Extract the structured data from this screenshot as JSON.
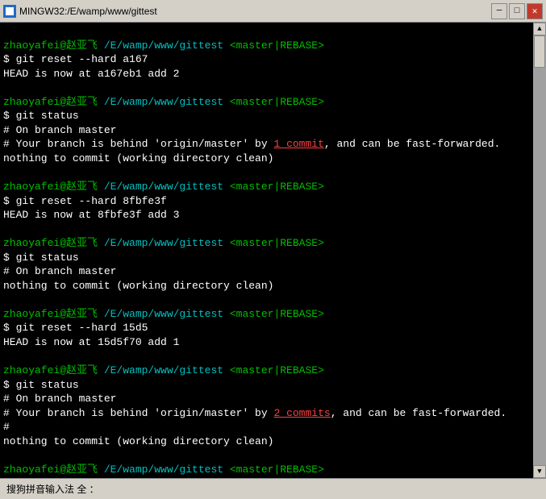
{
  "titlebar": {
    "title": "MINGW32:/E/wamp/www/gittest",
    "minimize_label": "─",
    "maximize_label": "□",
    "close_label": "✕"
  },
  "terminal": {
    "lines": [
      {
        "type": "prompt",
        "user": "zhaoyafei@",
        "cjk": "赵亚飞",
        "path": " /E/wamp/www/gittest",
        "branch": " <master|REBASE>"
      },
      {
        "type": "cmd",
        "text": "$ git reset --hard a167"
      },
      {
        "type": "output_white",
        "text": "HEAD is now at a167eb1 add 2"
      },
      {
        "type": "blank"
      },
      {
        "type": "prompt",
        "user": "zhaoyafei@",
        "cjk": "赵亚飞",
        "path": " /E/wamp/www/gittest",
        "branch": " <master|REBASE>"
      },
      {
        "type": "cmd",
        "text": "$ git status"
      },
      {
        "type": "output",
        "text": "# On branch master"
      },
      {
        "type": "mixed_1commit"
      },
      {
        "type": "output",
        "text": "nothing to commit (working directory clean)"
      },
      {
        "type": "blank"
      },
      {
        "type": "prompt",
        "user": "zhaoyafei@",
        "cjk": "赵亚飞",
        "path": " /E/wamp/www/gittest",
        "branch": " <master|REBASE>"
      },
      {
        "type": "cmd",
        "text": "$ git reset --hard 8fbfe3f"
      },
      {
        "type": "output_white",
        "text": "HEAD is now at 8fbfe3f add 3"
      },
      {
        "type": "blank"
      },
      {
        "type": "prompt",
        "user": "zhaoyafei@",
        "cjk": "赵亚飞",
        "path": " /E/wamp/www/gittest",
        "branch": " <master|REBASE>"
      },
      {
        "type": "cmd",
        "text": "$ git status"
      },
      {
        "type": "output",
        "text": "# On branch master"
      },
      {
        "type": "output",
        "text": "nothing to commit (working directory clean)"
      },
      {
        "type": "blank"
      },
      {
        "type": "prompt",
        "user": "zhaoyafei@",
        "cjk": "赵亚飞",
        "path": " /E/wamp/www/gittest",
        "branch": " <master|REBASE>"
      },
      {
        "type": "cmd",
        "text": "$ git reset --hard 15d5"
      },
      {
        "type": "output_white",
        "text": "HEAD is now at 15d5f70 add 1"
      },
      {
        "type": "blank"
      },
      {
        "type": "prompt",
        "user": "zhaoyafei@",
        "cjk": "赵亚飞",
        "path": " /E/wamp/www/gittest",
        "branch": " <master|REBASE>"
      },
      {
        "type": "cmd",
        "text": "$ git status"
      },
      {
        "type": "output",
        "text": "# On branch master"
      },
      {
        "type": "mixed_2commits"
      },
      {
        "type": "blank"
      },
      {
        "type": "output",
        "text": "#"
      },
      {
        "type": "output",
        "text": "nothing to commit (working directory clean)"
      },
      {
        "type": "blank"
      },
      {
        "type": "prompt",
        "user": "zhaoyafei@",
        "cjk": "赵亚飞",
        "path": " /E/wamp/www/gittest",
        "branch": " <master|REBASE>"
      },
      {
        "type": "cmd",
        "text": "$ "
      }
    ]
  },
  "statusbar": {
    "text": "搜狗拼音输入法  全  ："
  }
}
